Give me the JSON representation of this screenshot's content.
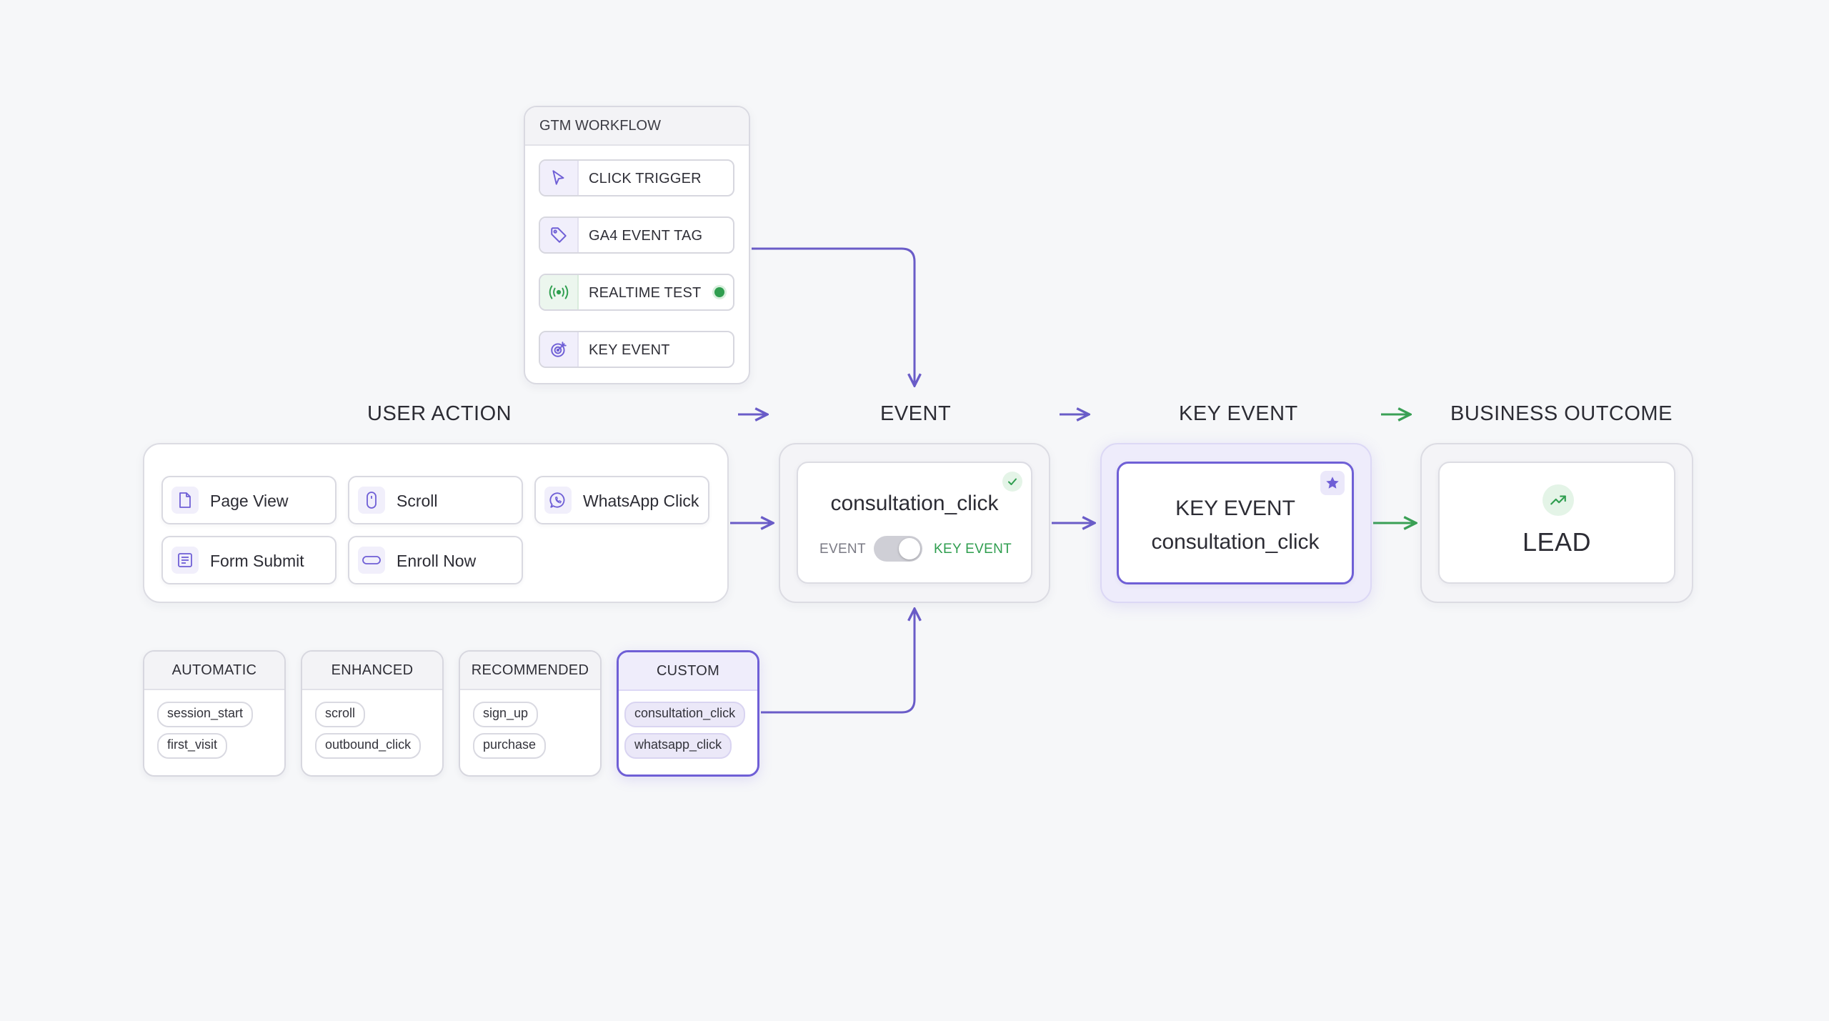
{
  "gtm": {
    "title": "GTM WORKFLOW",
    "steps": [
      {
        "label": "CLICK TRIGGER",
        "icon": "cursor-pointer-icon"
      },
      {
        "label": "GA4 EVENT TAG",
        "icon": "tag-icon"
      },
      {
        "label": "REALTIME TEST",
        "icon": "broadcast-icon",
        "status": "active"
      },
      {
        "label": "KEY EVENT",
        "icon": "target-icon"
      }
    ]
  },
  "stages": {
    "user_action": "USER ACTION",
    "event": "EVENT",
    "key_event": "KEY EVENT",
    "business_outcome": "BUSINESS OUTCOME"
  },
  "actions": [
    {
      "label": "Page View",
      "icon": "document-icon"
    },
    {
      "label": "Scroll",
      "icon": "mouse-icon"
    },
    {
      "label": "WhatsApp Click",
      "icon": "whatsapp-icon"
    },
    {
      "label": "Form Submit",
      "icon": "form-icon"
    },
    {
      "label": "Enroll Now",
      "icon": "button-icon"
    }
  ],
  "event_card": {
    "name": "consultation_click",
    "toggle_off_label": "EVENT",
    "toggle_on_label": "KEY EVENT",
    "toggle_on": true
  },
  "key_event_card": {
    "title": "KEY EVENT",
    "name": "consultation_click"
  },
  "outcome_card": {
    "label": "LEAD"
  },
  "categories": [
    {
      "title": "AUTOMATIC",
      "items": [
        "session_start",
        "first_visit"
      ]
    },
    {
      "title": "ENHANCED",
      "items": [
        "scroll",
        "outbound_click"
      ]
    },
    {
      "title": "RECOMMENDED",
      "items": [
        "sign_up",
        "purchase"
      ]
    },
    {
      "title": "CUSTOM",
      "items": [
        "consultation_click",
        "whatsapp_click"
      ]
    }
  ],
  "colors": {
    "accent": "#6f5fd6",
    "success": "#2f9e4f",
    "connector": "#6a5cc8",
    "background": "#f6f7f9"
  }
}
